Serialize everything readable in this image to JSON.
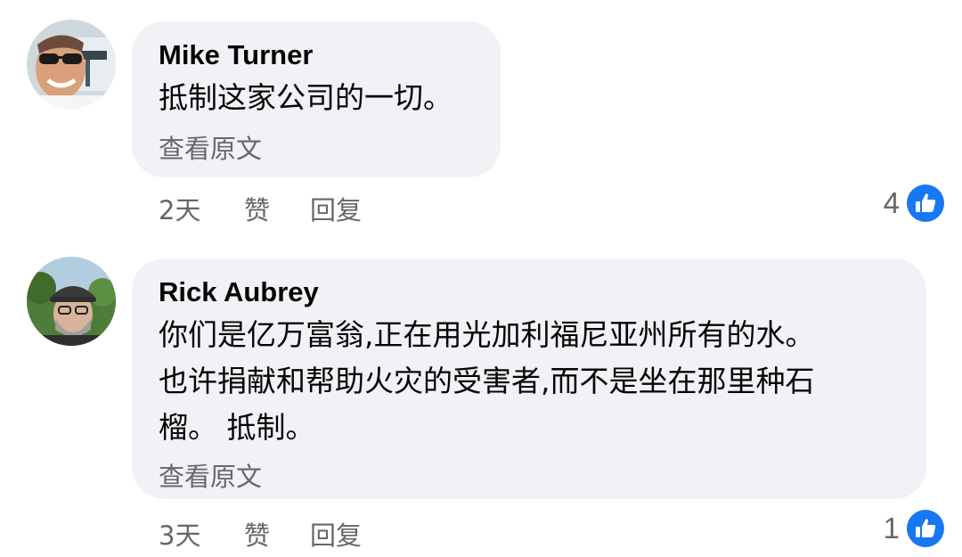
{
  "accent_color": "#1877f2",
  "comments": [
    {
      "author": "Mike Turner",
      "text": "抵制这家公司的一切。",
      "see_original": "查看原文",
      "time": "2天",
      "like_label": "赞",
      "reply_label": "回复",
      "reaction_count": "4",
      "reaction_icon": "thumbs-up-icon"
    },
    {
      "author": "Rick Aubrey",
      "text": "你们是亿万富翁,正在用光加利福尼亚州所有的水。\n也许捐献和帮助火灾的受害者,而不是坐在那里种石\n榴。 抵制。",
      "see_original": "查看原文",
      "time": "3天",
      "like_label": "赞",
      "reply_label": "回复",
      "reaction_count": "1",
      "reaction_icon": "thumbs-up-icon"
    }
  ]
}
